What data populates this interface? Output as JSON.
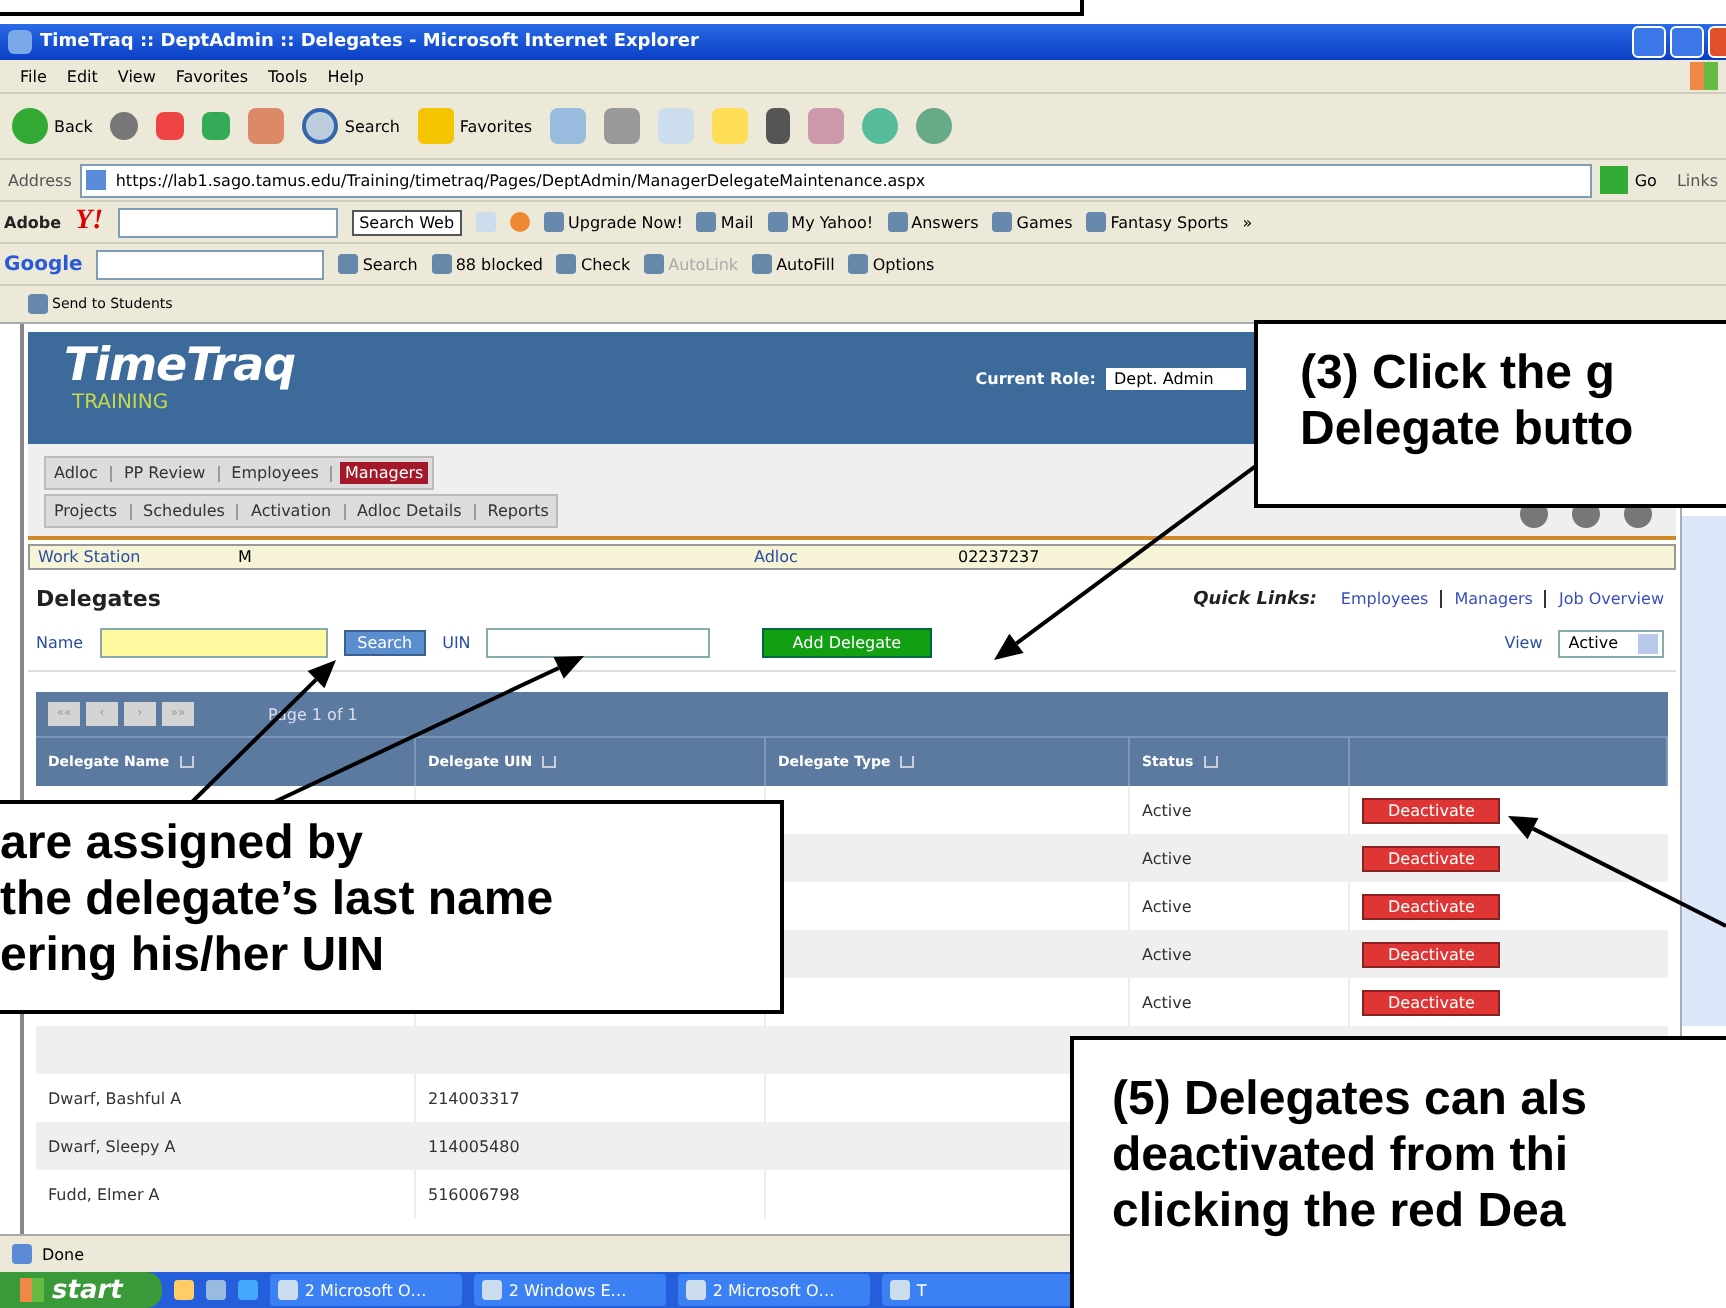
{
  "window": {
    "title": "TimeTraq :: DeptAdmin :: Delegates - Microsoft Internet Explorer"
  },
  "menu": [
    "File",
    "Edit",
    "View",
    "Favorites",
    "Tools",
    "Help"
  ],
  "toolbar": [
    {
      "kind": "labeled",
      "label": "Back"
    },
    {
      "kind": "icon"
    },
    {
      "kind": "icon"
    },
    {
      "kind": "icon"
    },
    {
      "kind": "icon"
    },
    {
      "kind": "labeled",
      "label": "Search"
    },
    {
      "kind": "labeled",
      "label": "Favorites"
    },
    {
      "kind": "icon"
    },
    {
      "kind": "icon"
    },
    {
      "kind": "icon"
    },
    {
      "kind": "icon"
    },
    {
      "kind": "icon"
    },
    {
      "kind": "icon"
    },
    {
      "kind": "icon"
    },
    {
      "kind": "icon"
    }
  ],
  "address": {
    "label": "Address",
    "url": "https://lab1.sago.tamus.edu/Training/timetraq/Pages/DeptAdmin/ManagerDelegateMaintenance.aspx",
    "go": "Go",
    "links": "Links"
  },
  "yahoo_toolbar": {
    "adobe": "Adobe",
    "logo": "Y!",
    "search_button": "Search Web",
    "items": [
      "Upgrade Now!",
      "Mail",
      "My Yahoo!",
      "Answers",
      "Games",
      "Fantasy Sports"
    ],
    "more": "»"
  },
  "google_toolbar": {
    "logo": "Google",
    "items": [
      {
        "label": "Search",
        "disabled": false
      },
      {
        "label": "88 blocked",
        "disabled": false
      },
      {
        "label": "Check",
        "disabled": false
      },
      {
        "label": "AutoLink",
        "disabled": true
      },
      {
        "label": "AutoFill",
        "disabled": false
      },
      {
        "label": "Options",
        "disabled": false
      }
    ]
  },
  "links_bar": {
    "items": [
      "Send to Students"
    ]
  },
  "page": {
    "header": {
      "title": "TimeTraq",
      "subtitle": "TRAINING",
      "role_label": "Current Role:",
      "role": "Dept. Admin"
    },
    "tabs_primary": [
      {
        "label": "Adloc",
        "selected": false
      },
      {
        "label": "PP Review",
        "selected": false
      },
      {
        "label": "Employees",
        "selected": false
      },
      {
        "label": "Managers",
        "selected": true
      }
    ],
    "tabs_secondary": [
      {
        "label": "Projects",
        "selected": false
      },
      {
        "label": "Schedules",
        "selected": false
      },
      {
        "label": "Activation",
        "selected": false
      },
      {
        "label": "Adloc Details",
        "selected": false
      },
      {
        "label": "Reports",
        "selected": false
      }
    ],
    "context": {
      "label": "Work Station",
      "code": "M",
      "type": "Adloc",
      "number": "02237237"
    },
    "title": "Delegates",
    "quick_links": {
      "label": "Quick Links:",
      "links": [
        "Employees",
        "Managers",
        "Job Overview"
      ]
    },
    "search": {
      "name_label": "Name",
      "search_button": "Search",
      "uin_label": "UIN",
      "add_button": "Add Delegate",
      "view_label": "View",
      "view": "Active"
    },
    "pager": {
      "buttons": [
        "««",
        "‹",
        "›",
        "»»"
      ],
      "text": "Page 1 of 1"
    },
    "table": {
      "columns": [
        "Delegate Name",
        "Delegate UIN",
        "Delegate Type",
        "Status"
      ],
      "rows": [
        {
          "status": "Active",
          "action": "Deactivate"
        },
        {
          "status": "Active",
          "action": "Deactivate"
        },
        {
          "status": "Active",
          "action": "Deactivate"
        },
        {
          "status": "Active",
          "action": "Deactivate"
        },
        {
          "status": "Active",
          "action": "Deactivate"
        },
        {},
        {
          "name": "Dwarf, Bashful A",
          "uin": "214003317"
        },
        {
          "name": "Dwarf, Sleepy A",
          "uin": "114005480"
        },
        {
          "name": "Fudd, Elmer A",
          "uin": "516006798"
        }
      ]
    }
  },
  "status_bar": {
    "text": "Done"
  },
  "taskbar": {
    "start": "start",
    "tasks": [
      "2 Microsoft O…",
      "2 Windows E…",
      "2 Microsoft O…",
      "T"
    ]
  },
  "callouts": [
    {
      "lines": [
        "(3) Click the g",
        "Delegate butto"
      ]
    },
    {
      "lines": [
        "are assigned by",
        "the delegate’s last name",
        "ering his/her UIN"
      ]
    },
    {
      "lines": [
        "(5) Delegates can als",
        "deactivated from thi",
        "clicking the red Dea"
      ]
    }
  ]
}
